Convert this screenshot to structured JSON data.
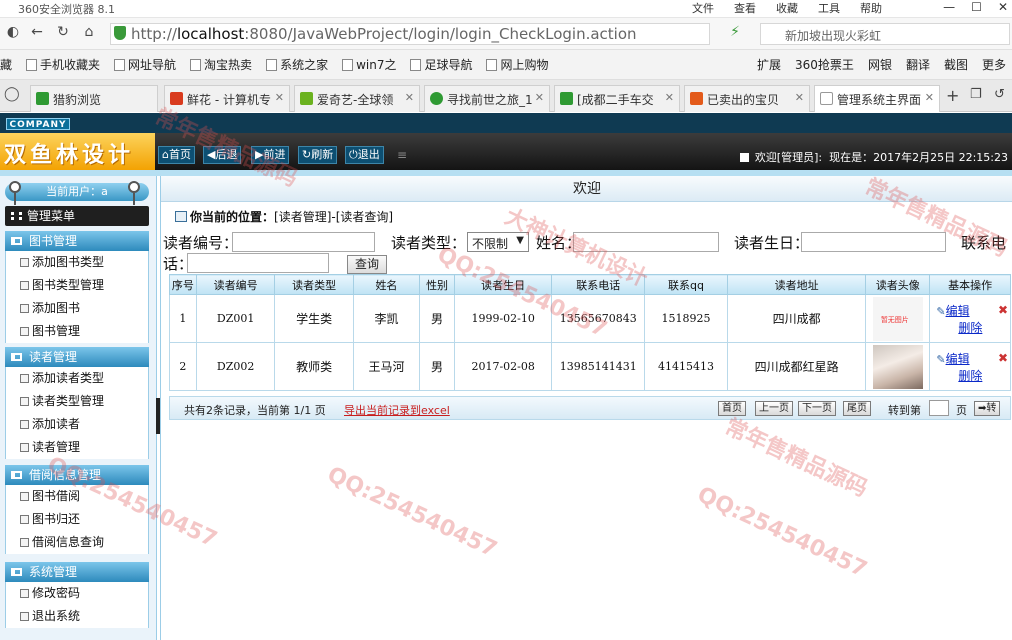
{
  "browser": {
    "title": "360安全浏览器 8.1",
    "menu": [
      "文件",
      "查看",
      "收藏",
      "工具",
      "帮助"
    ],
    "url_prefix": "http://",
    "url_host": "localhost",
    "url_path": ":8080/JavaWebProject/login/login_CheckLogin.action",
    "search_text": "新加坡出现火彩虹",
    "favorites": [
      "手机收藏夹",
      "网址导航",
      "淘宝热卖",
      "系统之家",
      "win7之",
      "足球导航",
      "网上购物"
    ],
    "favorites_prefix": "藏",
    "fav_right": [
      "扩展",
      "360抢票王",
      "网银",
      "翻译",
      "截图",
      "更多"
    ],
    "tabs": [
      {
        "label": "猎豹浏览",
        "color": "#2f9a33"
      },
      {
        "label": "鲜花 - 计算机专",
        "color": "#d93b1e"
      },
      {
        "label": "爱奇艺-全球领",
        "color": "#6bb21f"
      },
      {
        "label": "寻找前世之旅_1",
        "color": "#2f9a33"
      },
      {
        "label": "[成都二手车交",
        "color": "#2f9a33"
      },
      {
        "label": "已卖出的宝贝",
        "color": "#e35a1a"
      },
      {
        "label": "管理系统主界面",
        "color": "#bbbbbb"
      }
    ]
  },
  "header": {
    "company": "COMPANY",
    "logo": "双鱼林设计",
    "buttons": [
      "首页",
      "后退",
      "前进",
      "刷新",
      "退出"
    ],
    "welcome": "欢迎[管理员]:",
    "now": "现在是：2017年2月25日 22:15:23"
  },
  "sidebar": {
    "current_user": "当前用户：a",
    "menu_title": "管理菜单",
    "sections": [
      {
        "title": "图书管理",
        "items": [
          "添加图书类型",
          "图书类型管理",
          "添加图书",
          "图书管理"
        ]
      },
      {
        "title": "读者管理",
        "items": [
          "添加读者类型",
          "读者类型管理",
          "添加读者",
          "读者管理"
        ]
      },
      {
        "title": "借阅信息管理",
        "items": [
          "图书借阅",
          "图书归还",
          "借阅信息查询"
        ]
      },
      {
        "title": "系统管理",
        "items": [
          "修改密码",
          "退出系统"
        ]
      }
    ]
  },
  "content": {
    "title": "欢迎",
    "location_label": "你当前的位置：",
    "location_path": "[读者管理]-[读者查询]",
    "search": {
      "reader_no_label": "读者编号：",
      "reader_type_label": "读者类型：",
      "reader_type_value": "不限制",
      "name_label": "姓名：",
      "birthday_label": "读者生日：",
      "phone_label_1": "联系电",
      "phone_label_2": "话：",
      "query_button": "查询"
    },
    "table": {
      "headers": [
        "序号",
        "读者编号",
        "读者类型",
        "姓名",
        "性别",
        "读者生日",
        "联系电话",
        "联系qq",
        "读者地址",
        "读者头像",
        "基本操作"
      ],
      "rows": [
        {
          "index": "1",
          "no": "DZ001",
          "type": "学生类",
          "name": "李凯",
          "sex": "男",
          "birthday": "1999-02-10",
          "phone": "13565670843",
          "qq": "1518925",
          "address": "四川成都",
          "avatar_text": "暂无图片"
        },
        {
          "index": "2",
          "no": "DZ002",
          "type": "教师类",
          "name": "王马河",
          "sex": "男",
          "birthday": "2017-02-08",
          "phone": "13985141431",
          "qq": "41415413",
          "address": "四川成都红星路",
          "avatar_text": ""
        }
      ],
      "edit_label": "编辑",
      "delete_label": "删除"
    },
    "pager": {
      "info": "共有2条记录，当前第 1/1 页",
      "export": "导出当前记录到excel",
      "buttons": [
        "首页",
        "上一页",
        "下一页",
        "尾页"
      ],
      "goto_label": "转到第",
      "page_unit": "页",
      "go_button": "➡转"
    }
  },
  "watermark": [
    "QQ:254540457",
    "常年售精品源码",
    "大神计算机设计"
  ]
}
